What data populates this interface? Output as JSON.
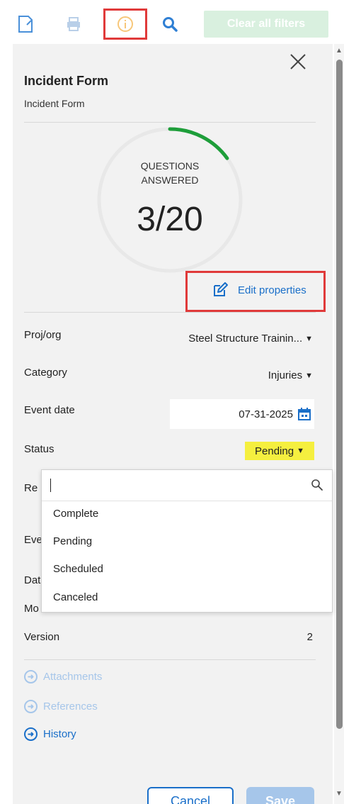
{
  "toolbar": {
    "icons": [
      "document-icon",
      "print-icon",
      "info-icon",
      "search-icon"
    ],
    "clear_filters_label": "Clear all filters"
  },
  "panel": {
    "title": "Incident Form",
    "subtitle": "Incident Form",
    "progress": {
      "label_line1": "QUESTIONS",
      "label_line2": "ANSWERED",
      "answered": 3,
      "total": 20,
      "count_text": "3/20"
    },
    "edit_properties_label": "Edit properties",
    "fields": {
      "proj_org": {
        "label": "Proj/org",
        "value": "Steel Structure Trainin..."
      },
      "category": {
        "label": "Category",
        "value": "Injuries"
      },
      "event_date": {
        "label": "Event date",
        "value": "07-31-2025"
      },
      "status": {
        "label": "Status",
        "value": "Pending"
      },
      "rep_label": "Re",
      "eve_label": "Eve",
      "dat_label": "Dat",
      "mo_label": "Mo",
      "version": {
        "label": "Version",
        "value": "2"
      }
    },
    "links": {
      "attachments": "Attachments",
      "references": "References",
      "history": "History"
    },
    "cancel_label": "Cancel",
    "save_label": "Save"
  },
  "status_dropdown": {
    "search_value": "",
    "options": [
      "Complete",
      "Pending",
      "Scheduled",
      "Canceled"
    ]
  },
  "colors": {
    "accent": "#1a6fc9",
    "progress_arc": "#1e9e3a",
    "highlight": "#f5ef3f",
    "annotation": "#e03a3a"
  }
}
